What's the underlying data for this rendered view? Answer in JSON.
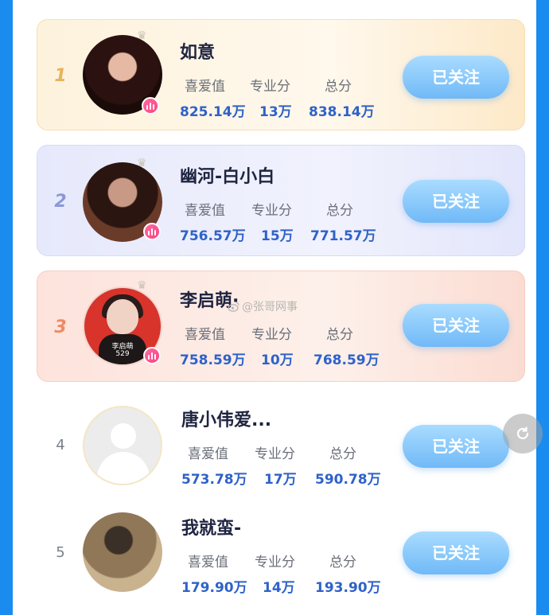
{
  "ranking": [
    {
      "rank": "1",
      "name": "如意",
      "stats": [
        {
          "label": "喜爱值",
          "value": "825.14万"
        },
        {
          "label": "专业分",
          "value": "13万"
        },
        {
          "label": "总分",
          "value": "838.14万"
        }
      ],
      "follow": "已关注"
    },
    {
      "rank": "2",
      "name": "幽河-白小白",
      "stats": [
        {
          "label": "喜爱值",
          "value": "756.57万"
        },
        {
          "label": "专业分",
          "value": "15万"
        },
        {
          "label": "总分",
          "value": "771.57万"
        }
      ],
      "follow": "已关注"
    },
    {
      "rank": "3",
      "name": "李启萌·",
      "avatar_text": "李启萌\n529",
      "stats": [
        {
          "label": "喜爱值",
          "value": "758.59万"
        },
        {
          "label": "专业分",
          "value": "10万"
        },
        {
          "label": "总分",
          "value": "768.59万"
        }
      ],
      "follow": "已关注"
    },
    {
      "rank": "4",
      "name": "唐小伟爱...",
      "stats": [
        {
          "label": "喜爱值",
          "value": "573.78万"
        },
        {
          "label": "专业分",
          "value": "17万"
        },
        {
          "label": "总分",
          "value": "590.78万"
        }
      ],
      "follow": "已关注"
    },
    {
      "rank": "5",
      "name": "我就蛮-",
      "stats": [
        {
          "label": "喜爱值",
          "value": "179.90万"
        },
        {
          "label": "专业分",
          "value": "14万"
        },
        {
          "label": "总分",
          "value": "193.90万"
        }
      ],
      "follow": "已关注"
    }
  ],
  "watermark": "@张哥网事",
  "icons": {
    "crown": "crown-icon",
    "badge": "chart-badge-icon",
    "refresh": "refresh-icon",
    "weibo": "weibo-icon"
  },
  "colors": {
    "follow_button": "#70b9f7",
    "value_text": "#2f62c9",
    "name_text": "#1f2441",
    "background": "#1a8cf0"
  }
}
